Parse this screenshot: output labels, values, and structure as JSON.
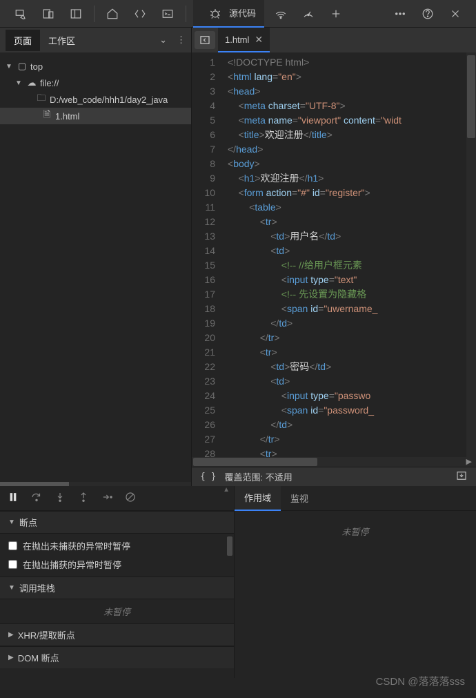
{
  "toolbar": {
    "active_tab_label": "源代码"
  },
  "sidebar": {
    "tabs": {
      "page": "页面",
      "workspace": "工作区"
    },
    "tree": {
      "top": "top",
      "file_protocol": "file://",
      "path": "D:/web_code/hhh1/day2_java",
      "file": "1.html"
    }
  },
  "editor": {
    "tab_label": "1.html",
    "lines": [
      [
        [
          "doc",
          "<!DOCTYPE html>"
        ]
      ],
      [
        [
          "pun",
          "<"
        ],
        [
          "tag",
          "html"
        ],
        [
          "txt",
          " "
        ],
        [
          "attr",
          "lang"
        ],
        [
          "pun",
          "="
        ],
        [
          "str",
          "\"en\""
        ],
        [
          "pun",
          ">"
        ]
      ],
      [
        [
          "pun",
          "<"
        ],
        [
          "tag",
          "head"
        ],
        [
          "pun",
          ">"
        ]
      ],
      [
        [
          "txt",
          "    "
        ],
        [
          "pun",
          "<"
        ],
        [
          "tag",
          "meta"
        ],
        [
          "txt",
          " "
        ],
        [
          "attr",
          "charset"
        ],
        [
          "pun",
          "="
        ],
        [
          "str",
          "\"UTF-8\""
        ],
        [
          "pun",
          ">"
        ]
      ],
      [
        [
          "txt",
          "    "
        ],
        [
          "pun",
          "<"
        ],
        [
          "tag",
          "meta"
        ],
        [
          "txt",
          " "
        ],
        [
          "attr",
          "name"
        ],
        [
          "pun",
          "="
        ],
        [
          "str",
          "\"viewport\""
        ],
        [
          "txt",
          " "
        ],
        [
          "attr",
          "content"
        ],
        [
          "pun",
          "="
        ],
        [
          "str",
          "\"widt"
        ]
      ],
      [
        [
          "txt",
          "    "
        ],
        [
          "pun",
          "<"
        ],
        [
          "tag",
          "title"
        ],
        [
          "pun",
          ">"
        ],
        [
          "txt",
          "欢迎注册"
        ],
        [
          "pun",
          "</"
        ],
        [
          "tag",
          "title"
        ],
        [
          "pun",
          ">"
        ]
      ],
      [
        [
          "pun",
          "</"
        ],
        [
          "tag",
          "head"
        ],
        [
          "pun",
          ">"
        ]
      ],
      [
        [
          "pun",
          "<"
        ],
        [
          "tag",
          "body"
        ],
        [
          "pun",
          ">"
        ]
      ],
      [
        [
          "txt",
          "    "
        ],
        [
          "pun",
          "<"
        ],
        [
          "tag",
          "h1"
        ],
        [
          "pun",
          ">"
        ],
        [
          "txt",
          "欢迎注册"
        ],
        [
          "pun",
          "</"
        ],
        [
          "tag",
          "h1"
        ],
        [
          "pun",
          ">"
        ]
      ],
      [
        [
          "txt",
          "    "
        ],
        [
          "pun",
          "<"
        ],
        [
          "tag",
          "form"
        ],
        [
          "txt",
          " "
        ],
        [
          "attr",
          "action"
        ],
        [
          "pun",
          "="
        ],
        [
          "str",
          "\"#\""
        ],
        [
          "txt",
          " "
        ],
        [
          "attr",
          "id"
        ],
        [
          "pun",
          "="
        ],
        [
          "str",
          "\"register\""
        ],
        [
          "pun",
          ">"
        ]
      ],
      [
        [
          "txt",
          "        "
        ],
        [
          "pun",
          "<"
        ],
        [
          "tag",
          "table"
        ],
        [
          "pun",
          ">"
        ]
      ],
      [
        [
          "txt",
          "            "
        ],
        [
          "pun",
          "<"
        ],
        [
          "tag",
          "tr"
        ],
        [
          "pun",
          ">"
        ]
      ],
      [
        [
          "txt",
          "                "
        ],
        [
          "pun",
          "<"
        ],
        [
          "tag",
          "td"
        ],
        [
          "pun",
          ">"
        ],
        [
          "txt",
          "用户名"
        ],
        [
          "pun",
          "</"
        ],
        [
          "tag",
          "td"
        ],
        [
          "pun",
          ">"
        ]
      ],
      [
        [
          "txt",
          "                "
        ],
        [
          "pun",
          "<"
        ],
        [
          "tag",
          "td"
        ],
        [
          "pun",
          ">"
        ]
      ],
      [
        [
          "txt",
          "                    "
        ],
        [
          "cmt",
          "<!-- //给用户框元素"
        ]
      ],
      [
        [
          "txt",
          "                    "
        ],
        [
          "pun",
          "<"
        ],
        [
          "tag",
          "input"
        ],
        [
          "txt",
          " "
        ],
        [
          "attr",
          "type"
        ],
        [
          "pun",
          "="
        ],
        [
          "str",
          "\"text\""
        ]
      ],
      [
        [
          "txt",
          "                    "
        ],
        [
          "cmt",
          "<!-- 先设置为隐藏格"
        ]
      ],
      [
        [
          "txt",
          "                    "
        ],
        [
          "pun",
          "<"
        ],
        [
          "tag",
          "span"
        ],
        [
          "txt",
          " "
        ],
        [
          "attr",
          "id"
        ],
        [
          "pun",
          "="
        ],
        [
          "str",
          "\"uwername_"
        ]
      ],
      [
        [
          "txt",
          "                "
        ],
        [
          "pun",
          "</"
        ],
        [
          "tag",
          "td"
        ],
        [
          "pun",
          ">"
        ]
      ],
      [
        [
          "txt",
          "            "
        ],
        [
          "pun",
          "</"
        ],
        [
          "tag",
          "tr"
        ],
        [
          "pun",
          ">"
        ]
      ],
      [
        [
          "txt",
          "            "
        ],
        [
          "pun",
          "<"
        ],
        [
          "tag",
          "tr"
        ],
        [
          "pun",
          ">"
        ]
      ],
      [
        [
          "txt",
          "                "
        ],
        [
          "pun",
          "<"
        ],
        [
          "tag",
          "td"
        ],
        [
          "pun",
          ">"
        ],
        [
          "txt",
          "密码"
        ],
        [
          "pun",
          "</"
        ],
        [
          "tag",
          "td"
        ],
        [
          "pun",
          ">"
        ]
      ],
      [
        [
          "txt",
          "                "
        ],
        [
          "pun",
          "<"
        ],
        [
          "tag",
          "td"
        ],
        [
          "pun",
          ">"
        ]
      ],
      [
        [
          "txt",
          "                    "
        ],
        [
          "pun",
          "<"
        ],
        [
          "tag",
          "input"
        ],
        [
          "txt",
          " "
        ],
        [
          "attr",
          "type"
        ],
        [
          "pun",
          "="
        ],
        [
          "str",
          "\"passwo"
        ]
      ],
      [
        [
          "txt",
          "                    "
        ],
        [
          "pun",
          "<"
        ],
        [
          "tag",
          "span"
        ],
        [
          "txt",
          " "
        ],
        [
          "attr",
          "id"
        ],
        [
          "pun",
          "="
        ],
        [
          "str",
          "\"password_"
        ]
      ],
      [
        [
          "txt",
          "                "
        ],
        [
          "pun",
          "</"
        ],
        [
          "tag",
          "td"
        ],
        [
          "pun",
          ">"
        ]
      ],
      [
        [
          "txt",
          "            "
        ],
        [
          "pun",
          "</"
        ],
        [
          "tag",
          "tr"
        ],
        [
          "pun",
          ">"
        ]
      ],
      [
        [
          "txt",
          "            "
        ],
        [
          "pun",
          "<"
        ],
        [
          "tag",
          "tr"
        ],
        [
          "pun",
          ">"
        ]
      ]
    ]
  },
  "coverage": {
    "label": "覆盖范围: 不适用"
  },
  "debug": {
    "breakpoints_title": "断点",
    "bp_uncaught": "在抛出未捕获的异常时暂停",
    "bp_caught": "在抛出捕获的异常时暂停",
    "callstack_title": "调用堆栈",
    "not_paused": "未暂停",
    "xhr_title": "XHR/提取断点",
    "dom_title": "DOM 断点"
  },
  "scope": {
    "tab_scope": "作用域",
    "tab_watch": "监视",
    "not_paused": "未暂停"
  },
  "watermark": "CSDN @落落落sss"
}
